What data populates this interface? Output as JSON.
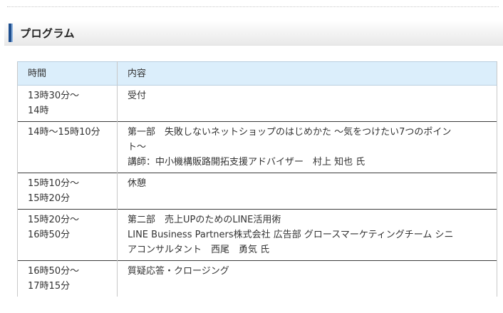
{
  "section": {
    "title": "プログラム"
  },
  "table": {
    "headers": {
      "time": "時間",
      "content": "内容"
    },
    "rows": [
      {
        "time": [
          "13時30分～",
          "14時"
        ],
        "content": [
          "受付"
        ]
      },
      {
        "time": [
          "14時～15時10分"
        ],
        "content": [
          "第一部　失敗しないネットショップのはじめかた ～気をつけたい7つのポイン",
          "ト～",
          "講師：中小機構販路開拓支援アドバイザー　村上 知也 氏"
        ]
      },
      {
        "time": [
          "15時10分～",
          "15時20分"
        ],
        "content": [
          "休憩"
        ]
      },
      {
        "time": [
          "15時20分～",
          "16時50分"
        ],
        "content": [
          "第二部　売上UPのためのLINE活用術",
          "LINE Business Partners株式会社 広告部 グロースマーケティングチーム シニ",
          "アコンサルタント　西尾　勇気 氏"
        ]
      },
      {
        "time": [
          "16時50分～",
          "17時15分"
        ],
        "content": [
          "質疑応答・クロージング"
        ]
      }
    ]
  }
}
